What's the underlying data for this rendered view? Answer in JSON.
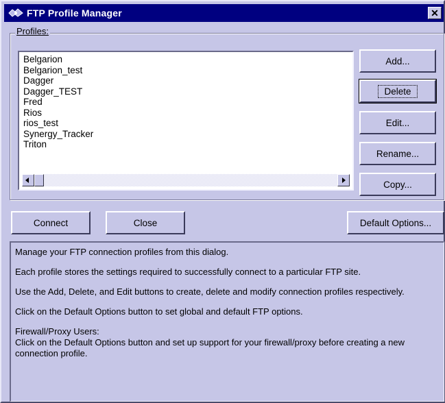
{
  "window": {
    "title": "FTP Profile Manager",
    "close_label": "✕"
  },
  "profiles_group": {
    "label": "Profiles:",
    "items": [
      "Belgarion",
      "Belgarion_test",
      "Dagger",
      "Dagger_TEST",
      "Fred",
      "Rios",
      "rios_test",
      "Synergy_Tracker",
      "Triton"
    ]
  },
  "side_buttons": {
    "add": "Add...",
    "delete": "Delete",
    "edit": "Edit...",
    "rename": "Rename...",
    "copy": "Copy..."
  },
  "bottom_buttons": {
    "connect": "Connect",
    "close": "Close",
    "default_options": "Default Options..."
  },
  "info": {
    "p1": "Manage your FTP connection profiles from this dialog.",
    "p2": "Each profile stores the settings required to successfully connect to a particular FTP site.",
    "p3": "Use the Add, Delete, and Edit buttons to create, delete and modify connection profiles respectively.",
    "p4": "Click on the Default Options button to set global and default FTP options.",
    "p5_title": "Firewall/Proxy Users:",
    "p5_body": "Click on the Default Options button and set up support for your firewall/proxy before creating a new connection profile."
  },
  "icons": {
    "app": "ftp-app-icon",
    "close": "close-icon",
    "scroll_left": "scroll-left-icon",
    "scroll_right": "scroll-right-icon"
  },
  "colors": {
    "face": "#c6c6e7",
    "titlebar": "#000080",
    "list_bg": "#ffffff"
  }
}
